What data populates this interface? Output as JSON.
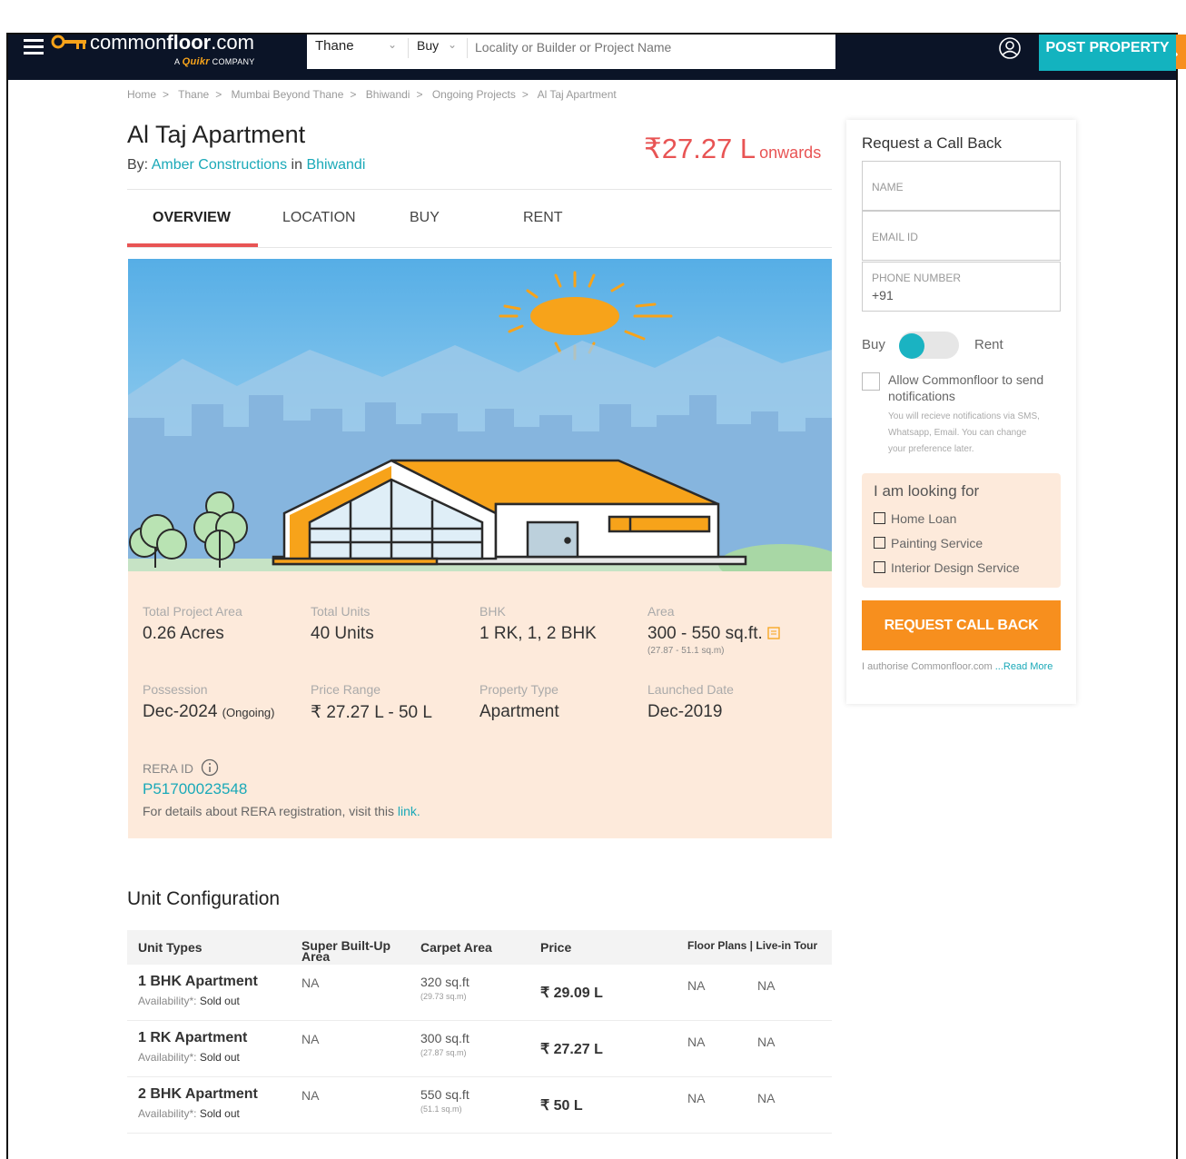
{
  "header": {
    "logo_main": "common",
    "logo_bold": "floor",
    "logo_suffix": ".com",
    "logo_sub_prefix": "A",
    "logo_sub_brand": "Quikr",
    "logo_sub_suffix": "COMPANY",
    "city": "Thane",
    "mode": "Buy",
    "search_placeholder": "Locality or Builder or Project Name",
    "post_property": "POST PROPERTY"
  },
  "breadcrumb": [
    "Home",
    "Thane",
    "Mumbai Beyond Thane",
    "Bhiwandi",
    "Ongoing Projects",
    "Al Taj Apartment"
  ],
  "project": {
    "name": "Al Taj Apartment",
    "by_label": "By:",
    "builder": "Amber Constructions",
    "in_label": "in",
    "locality": "Bhiwandi",
    "price": "₹27.27 L",
    "price_suffix": "onwards"
  },
  "tabs": [
    {
      "label": "OVERVIEW",
      "active": true
    },
    {
      "label": "LOCATION",
      "active": false
    },
    {
      "label": "BUY",
      "active": false
    },
    {
      "label": "RENT",
      "active": false
    }
  ],
  "details": {
    "total_area": {
      "label": "Total Project Area",
      "value": "0.26 Acres"
    },
    "total_units": {
      "label": "Total Units",
      "value": "40 Units"
    },
    "bhk": {
      "label": "BHK",
      "value": "1 RK, 1, 2 BHK"
    },
    "area": {
      "label": "Area",
      "value": "300 - 550 sq.ft.",
      "sub": "(27.87 - 51.1 sq.m)"
    },
    "possession": {
      "label": "Possession",
      "value": "Dec-2024",
      "status": "(Ongoing)"
    },
    "price_range": {
      "label": "Price Range",
      "value": "₹ 27.27 L - 50 L"
    },
    "property_type": {
      "label": "Property Type",
      "value": "Apartment"
    },
    "launched": {
      "label": "Launched Date",
      "value": "Dec-2019"
    },
    "rera": {
      "label": "RERA ID",
      "id": "P51700023548",
      "details_text": "For details about RERA registration, visit this",
      "link_text": "link."
    }
  },
  "unit_config": {
    "title": "Unit Configuration",
    "headers": [
      "Unit Types",
      "Super Built-Up Area",
      "Carpet Area",
      "Price",
      "Floor Plans | Live-in Tour"
    ],
    "availability_label": "Availability*:",
    "rows": [
      {
        "type": "1 BHK Apartment",
        "availability": "Sold out",
        "super": "NA",
        "carpet": "320 sq.ft",
        "carpet_sqm": "(29.73 sq.m)",
        "price": "₹ 29.09 L",
        "floor_plan": "NA",
        "tour": "NA"
      },
      {
        "type": "1 RK Apartment",
        "availability": "Sold out",
        "super": "NA",
        "carpet": "300 sq.ft",
        "carpet_sqm": "(27.87 sq.m)",
        "price": "₹ 27.27 L",
        "floor_plan": "NA",
        "tour": "NA"
      },
      {
        "type": "2 BHK Apartment",
        "availability": "Sold out",
        "super": "NA",
        "carpet": "550 sq.ft",
        "carpet_sqm": "(51.1 sq.m)",
        "price": "₹ 50 L",
        "floor_plan": "NA",
        "tour": "NA"
      }
    ]
  },
  "callback": {
    "title": "Request a Call Back",
    "name_placeholder": "NAME",
    "email_placeholder": "EMAIL ID",
    "phone_label": "PHONE NUMBER",
    "phone_prefix": "+91",
    "buy": "Buy",
    "rent": "Rent",
    "allow_text": "Allow Commonfloor to send notifications",
    "allow_sub": "You will recieve notifications via SMS, Whatsapp, Email. You can change your preference later.",
    "looking_title": "I am looking for",
    "looking_options": [
      "Home Loan",
      "Painting Service",
      "Interior Design Service"
    ],
    "button": "REQUEST CALL BACK",
    "auth_text": "I authorise Commonfloor.com",
    "read_more": "...Read More"
  },
  "colors": {
    "accent_orange": "#f78f1e",
    "teal": "#13b3bf",
    "price_red": "#e85454",
    "header_bg": "#0b1427",
    "info_bg": "#fdeadb"
  }
}
